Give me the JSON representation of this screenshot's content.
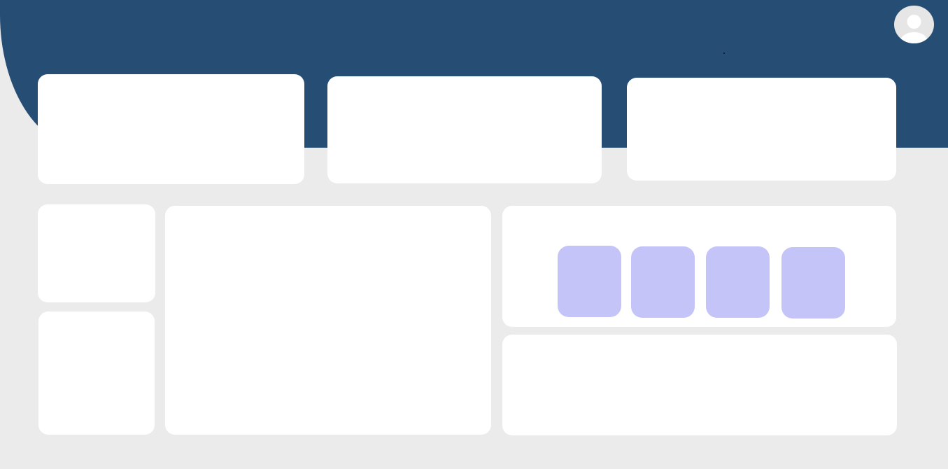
{
  "header": {
    "avatar_icon": "user-avatar-icon",
    "accent_color": "#264d73"
  },
  "stats_cards": [
    {
      "label": "",
      "value": ""
    },
    {
      "label": "",
      "value": ""
    },
    {
      "label": "",
      "value": ""
    }
  ],
  "side_cards": [
    {
      "label": ""
    },
    {
      "label": ""
    }
  ],
  "main_panel": {
    "title": ""
  },
  "tiles_panel": {
    "tiles": [
      {
        "label": ""
      },
      {
        "label": ""
      },
      {
        "label": ""
      },
      {
        "label": ""
      }
    ],
    "tile_color": "#c4c4f9"
  },
  "bottom_panel": {
    "title": ""
  },
  "colors": {
    "background": "#ebebeb",
    "card": "#ffffff"
  }
}
